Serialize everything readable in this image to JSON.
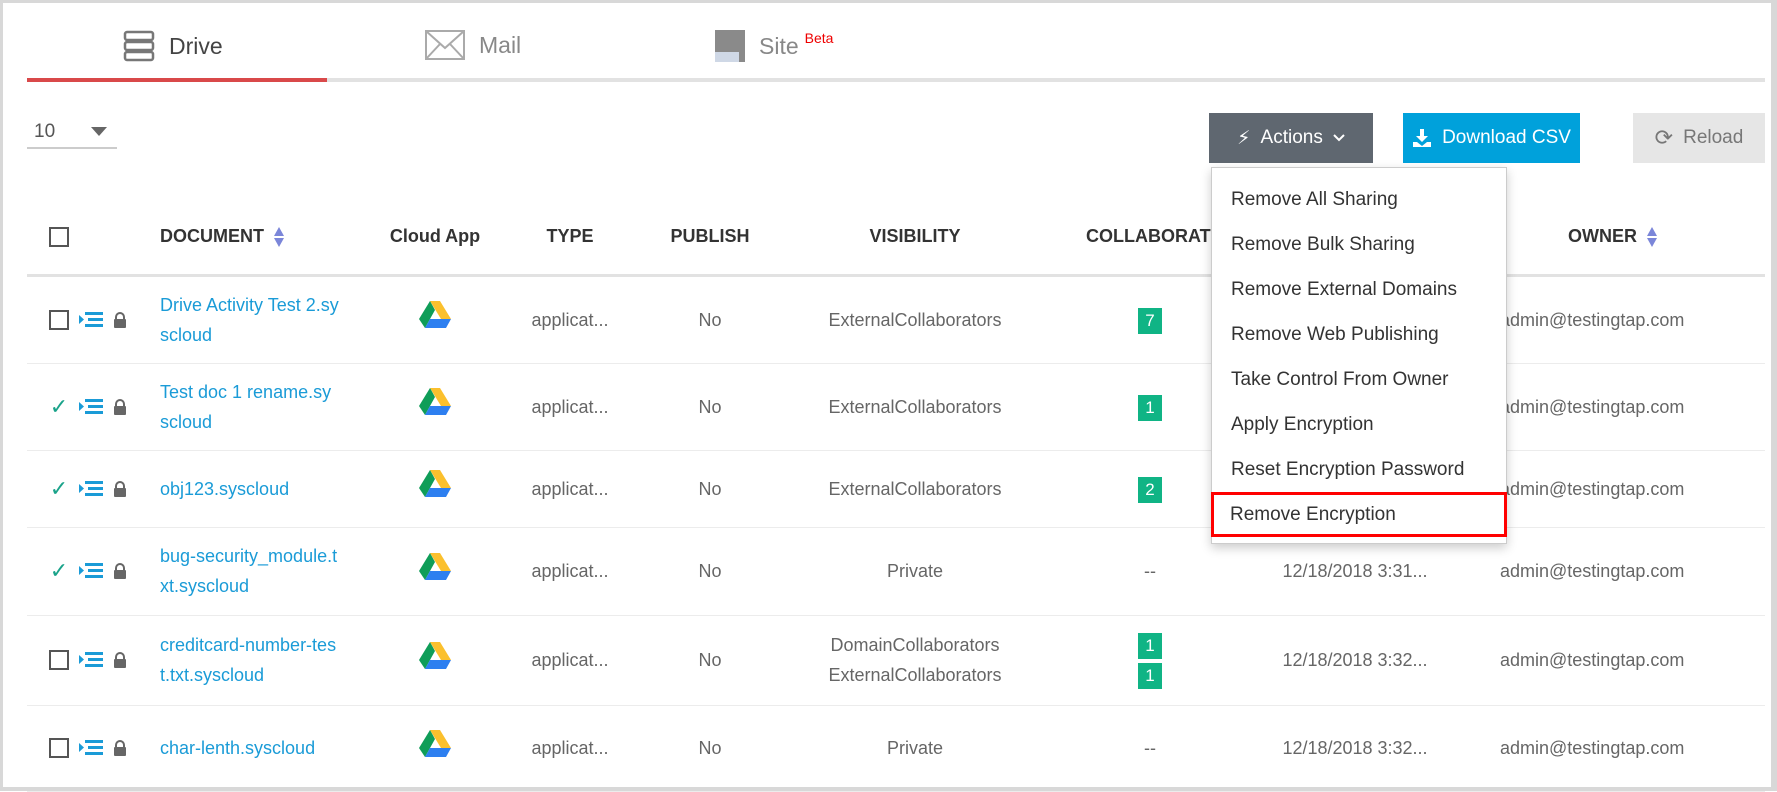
{
  "tabs": [
    {
      "label": "Drive",
      "icon": "server-icon",
      "active": true
    },
    {
      "label": "Mail",
      "icon": "envelope-icon"
    },
    {
      "label": "Site",
      "icon": "site-icon",
      "badge": "Beta"
    }
  ],
  "page_size": "10",
  "toolbar": {
    "actions": "Actions",
    "download": "Download CSV",
    "reload": "Reload"
  },
  "columns": [
    "DOCUMENT",
    "Cloud App",
    "TYPE",
    "PUBLISH",
    "VISIBILITY",
    "COLLABORATO",
    "",
    "OWNER"
  ],
  "actions_menu": [
    "Remove All Sharing",
    "Remove Bulk Sharing",
    "Remove External Domains",
    "Remove Web Publishing",
    "Take Control From Owner",
    "Apply Encryption",
    "Reset Encryption Password",
    "Remove Encryption"
  ],
  "highlighted_menu_item": "Remove Encryption",
  "colors": {
    "accent_tab": "#d9494a",
    "actions_btn": "#5f6770",
    "csv_btn": "#00a1db",
    "badge": "#10b485",
    "link": "#1a9bd7",
    "highlight": "#ff0000"
  },
  "rows": [
    {
      "checked": false,
      "document": "Drive Activity Test 2.syscloud",
      "type": "applicat...",
      "publish": "No",
      "visibility": [
        "ExternalCollaborators"
      ],
      "collaborators": [
        "7"
      ],
      "date": "",
      "owner": "admin@testingtap.com"
    },
    {
      "checked": true,
      "document": "Test doc 1 rename.syscloud",
      "type": "applicat...",
      "publish": "No",
      "visibility": [
        "ExternalCollaborators"
      ],
      "collaborators": [
        "1"
      ],
      "date": "",
      "owner": "admin@testingtap.com"
    },
    {
      "checked": true,
      "document": "obj123.syscloud",
      "type": "applicat...",
      "publish": "No",
      "visibility": [
        "ExternalCollaborators"
      ],
      "collaborators": [
        "2"
      ],
      "date": "",
      "owner": "admin@testingtap.com"
    },
    {
      "checked": true,
      "document": "bug-security_module.txt.syscloud",
      "type": "applicat...",
      "publish": "No",
      "visibility": [
        "Private"
      ],
      "collaborators": "--",
      "date": "12/18/2018 3:31...",
      "owner": "admin@testingtap.com"
    },
    {
      "checked": false,
      "document": "creditcard-number-test.txt.syscloud",
      "type": "applicat...",
      "publish": "No",
      "visibility": [
        "DomainCollaborators",
        "ExternalCollaborators"
      ],
      "collaborators": [
        "1",
        "1"
      ],
      "date": "12/18/2018 3:32...",
      "owner": "admin@testingtap.com"
    },
    {
      "checked": false,
      "document": "char-lenth.syscloud",
      "type": "applicat...",
      "publish": "No",
      "visibility": [
        "Private"
      ],
      "collaborators": "--",
      "date": "12/18/2018 3:32...",
      "owner": "admin@testingtap.com"
    }
  ]
}
